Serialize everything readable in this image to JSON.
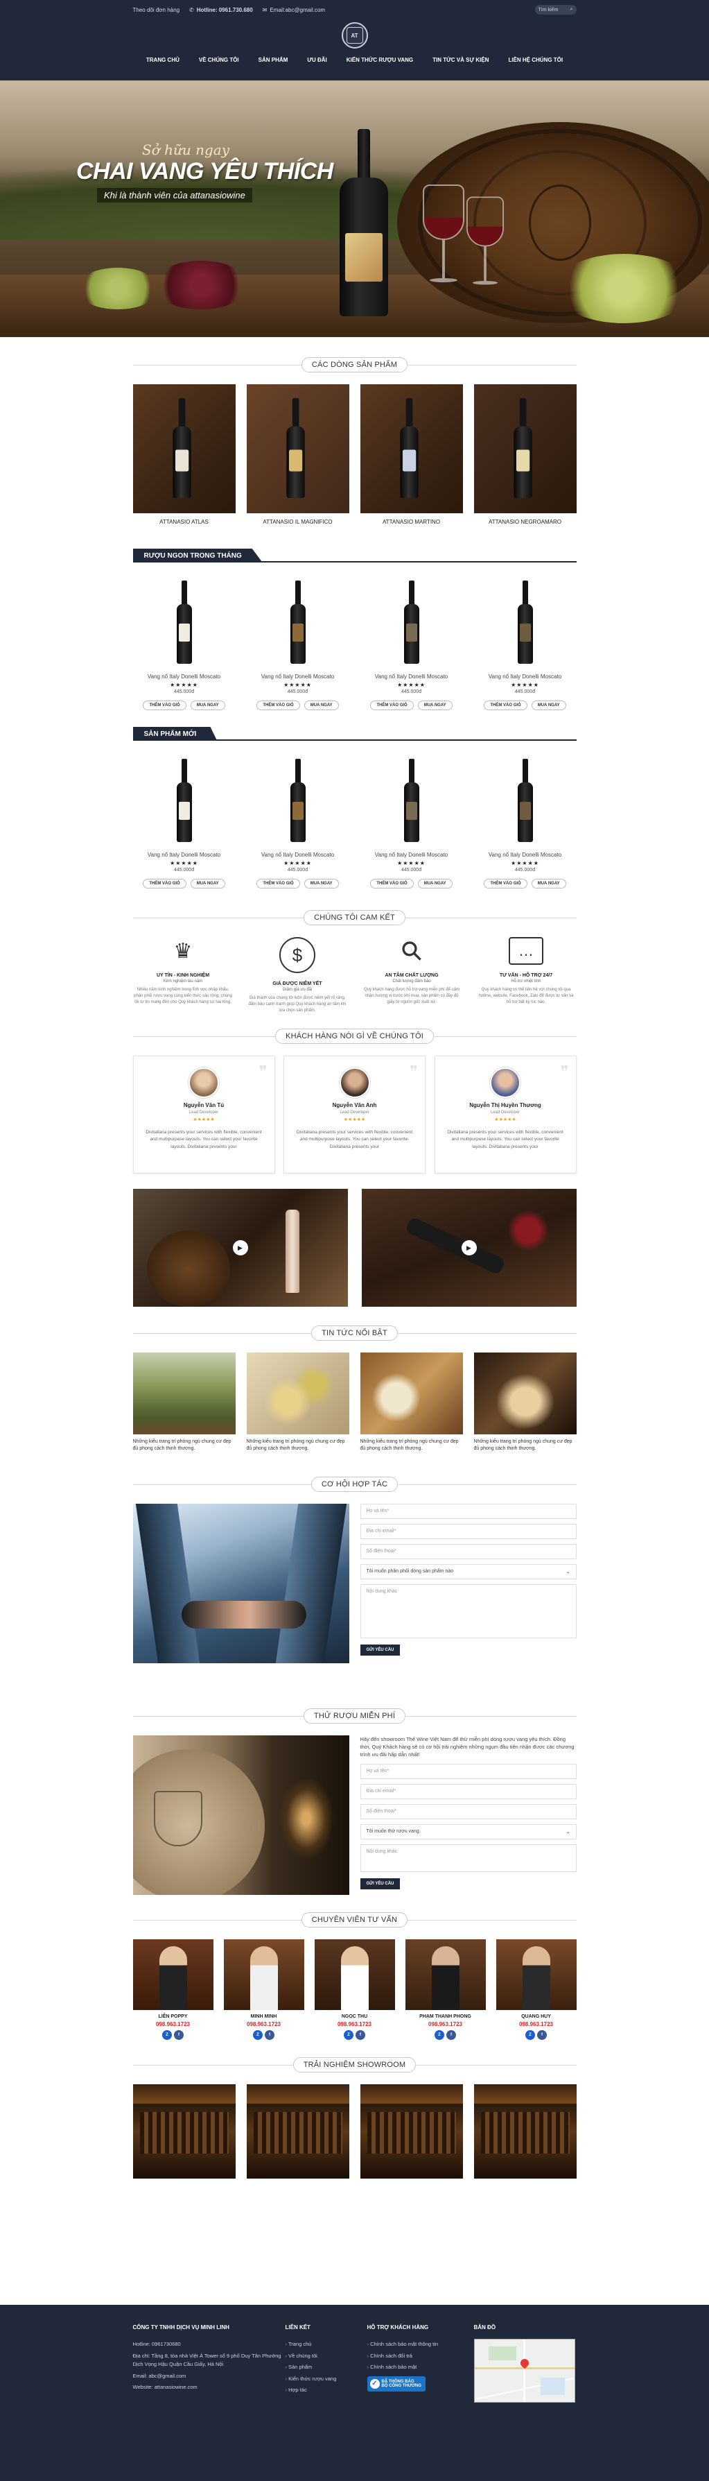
{
  "topbar": {
    "hours": "Theo dõi đơn hàng",
    "hotline": "Hotline: 0961.730.680",
    "email": "Email:abc@gmail.com",
    "search_placeholder": "Tìm kiếm"
  },
  "logo": {
    "text": "AT"
  },
  "nav": [
    "TRANG CHỦ",
    "VỀ CHÚNG TÔI",
    "SẢN PHẨM",
    "ƯU ĐÃI",
    "KIẾN THỨC RƯỢU VANG",
    "TIN TỨC VÀ SỰ KIỆN",
    "LIÊN HỆ CHÚNG TÔI"
  ],
  "hero": {
    "line1": "Sở hữu ngay",
    "line2": "CHAI VANG YÊU THÍCH",
    "line3": "Khi là thành viên của attanasiowine"
  },
  "categories": {
    "title": "CÁC DÒNG SẢN PHẨM",
    "items": [
      "ATTANASIO ATLAS",
      "ATTANASIO IL MAGNIFICO",
      "ATTANASIO MARTINO",
      "ATTANASIO NEGROAMARO"
    ]
  },
  "month_products": {
    "title": "RƯỢU NGON TRONG THÁNG",
    "items": [
      {
        "name": "Vang nổ Italy Donelli Moscato",
        "stars": "★★★★★",
        "price": "445.000đ"
      },
      {
        "name": "Vang nổ Italy Donelli Moscato",
        "stars": "★★★★★",
        "price": "445.000đ"
      },
      {
        "name": "Vang nổ Italy Donelli Moscato",
        "stars": "★★★★★",
        "price": "445.000đ"
      },
      {
        "name": "Vang nổ Italy Donelli Moscato",
        "stars": "★★★★★",
        "price": "445.000đ"
      }
    ],
    "cart_label": "THÊM VÀO GIỎ",
    "buy_label": "MUA NGAY"
  },
  "new_products": {
    "title": "SẢN PHẨM MỚI",
    "items": [
      {
        "name": "Vang nổ Italy Donelli Moscato",
        "stars": "★★★★★",
        "price": "445.000đ"
      },
      {
        "name": "Vang nổ Italy Donelli Moscato",
        "stars": "★★★★★",
        "price": "445.000đ"
      },
      {
        "name": "Vang nổ Italy Donelli Moscato",
        "stars": "★★★★★",
        "price": "445.000đ"
      },
      {
        "name": "Vang nổ Italy Donelli Moscato",
        "stars": "★★★★★",
        "price": "445.000đ"
      }
    ],
    "cart_label": "THÊM VÀO GIỎ",
    "buy_label": "MUA NGAY"
  },
  "commitments": {
    "title": "CHÚNG TÔI CAM KẾT",
    "items": [
      {
        "icon": "crown-person-icon",
        "glyph": "♛",
        "title": "UY TÍN - KINH NGHIỆM",
        "sub": "Kinh nghiệm lâu năm",
        "text": "Nhiều năm kinh nghiệm trong lĩnh vực nhập khẩu, phân phối rượu vang cùng kiến thức sâu rộng, chúng tôi tự tin mang đến cho Quý khách hàng sự hài lòng."
      },
      {
        "icon": "dollar-icon",
        "glyph": "$",
        "title": "GIÁ ĐƯỢC NIÊM YẾT",
        "sub": "Giảm giá ưu đãi",
        "text": "Giá thành của chúng tôi luôn được niêm yết rõ ràng, đảm bảo cạnh tranh giúp Quý khách hàng an tâm khi lựa chọn sản phẩm."
      },
      {
        "icon": "magnifier-icon",
        "glyph": "⚲",
        "title": "AN TÂM CHẤT LƯỢNG",
        "sub": "Chất lượng đảm bảo",
        "text": "Quý khách hàng được hỗ trợ vang miễn phí để cảm nhận hương vị trước khi mua, sản phẩm có đầy đủ giấy tờ nguồn gốc xuất xứ."
      },
      {
        "icon": "chat-icon",
        "glyph": "…",
        "title": "TƯ VẤN - HỖ TRỢ 24/7",
        "sub": "Hỗ trợ nhiệt tình",
        "text": "Quý khách hàng có thể liên hệ với chúng tôi qua hotline, website, Facebook, Zalo để được tư vấn và hỗ trợ bất kỳ lúc nào."
      }
    ]
  },
  "testimonials": {
    "title": "KHÁCH HÀNG NÓI GÌ VỀ CHÚNG TÔI",
    "items": [
      {
        "name": "Nguyễn Văn Tú",
        "role": "Lead Developer",
        "stars": "★★★★★",
        "text": "Divitaliana presents your services with flexible, convenient and multipurpose layouts. You can select your favorite layouts. Divitaliana presents your"
      },
      {
        "name": "Nguyễn Văn Anh",
        "role": "Lead Developer",
        "stars": "★★★★★",
        "text": "Divitaliana presents your services with flexible, convenient and multipurpose layouts. You can select your favorite. Divitaliana presents your"
      },
      {
        "name": "Nguyễn Thị Huyền Thương",
        "role": "Lead Developer",
        "stars": "★★★★★",
        "text": "Divitaliana presents your services with flexible, convenient and multipurpose layouts. You can select your favorite layouts. Divitaliana presents your"
      }
    ]
  },
  "news": {
    "title": "TIN TỨC NỔI BẬT",
    "items": [
      "Những kiểu trang trí phòng ngủ chung cư đẹp đủ phong cách thịnh thượng.",
      "Những kiểu trang trí phòng ngủ chung cư đẹp đủ phong cách thịnh thượng.",
      "Những kiểu trang trí phòng ngủ chung cư đẹp đủ phong cách thịnh thượng.",
      "Những kiểu trang trí phòng ngủ chung cư đẹp đủ phong cách thịnh thượng."
    ]
  },
  "cooperation": {
    "title": "CƠ HỘI HỢP TÁC",
    "name_ph": "Họ và tên*",
    "email_ph": "Địa chỉ email*",
    "phone_ph": "Số điện thoại*",
    "select": "Tôi muốn phân phối dòng sản phẩm nào",
    "msg_ph": "Nội dung khác",
    "submit": "GỬI YÊU CẦU"
  },
  "free_tasting": {
    "title": "THỬ RƯỢU MIỄN PHÍ",
    "intro": "Hãy đến showroom Thế Wine Việt Nam để thử miễn phí dòng rượu vang yêu thích. Đồng thời, Quý Khách hàng sẽ có cơ hội trải nghiệm những ngụm đầu tiên nhận được các chương trình ưu đãi hấp dẫn nhất!",
    "name_ph": "Họ và tên*",
    "email_ph": "Địa chỉ email*",
    "phone_ph": "Số điện thoại*",
    "select": "Tôi muốn thử rượu vang",
    "msg_ph": "Nội dung khác",
    "submit": "GỬI YÊU CẦU"
  },
  "advisors": {
    "title": "CHUYÊN VIÊN TƯ VẤN",
    "items": [
      {
        "name": "LIÊN POPPY",
        "phone": "098.963.1723"
      },
      {
        "name": "MINH MINH",
        "phone": "098.963.1723"
      },
      {
        "name": "NGỌC THU",
        "phone": "098.963.1723"
      },
      {
        "name": "PHẠM THANH PHONG",
        "phone": "098.963.1723"
      },
      {
        "name": "QUANG HUY",
        "phone": "098.963.1723"
      }
    ]
  },
  "showroom": {
    "title": "TRẢI NGHIỆM SHOWROOM"
  },
  "footer": {
    "company": "CÔNG TY TNHH DỊCH VỤ MINH LINH",
    "hotline": "Hotline: 0961730680",
    "address": "Địa chỉ: Tầng 8, tòa nhà Việt Á Tower số 9 phố Duy Tân Phường Dịch Vọng Hậu Quận Cầu Giấy, Hà Nội",
    "email": "Email: abc@gmail.com",
    "website": "Website: attanasiowine.com",
    "links_title": "LIÊN KẾT",
    "links": [
      "Trang chủ",
      "Về chúng tôi",
      "Sản phẩm",
      "Kiến thức rượu vang",
      "Hợp tác"
    ],
    "support_title": "HỖ TRỢ KHÁCH HÀNG",
    "support": [
      "Chính sách bảo mật thông tin",
      "Chính sách đổi trả",
      "Chính sách bảo mật"
    ],
    "bct_line1": "ĐÃ THÔNG BÁO",
    "bct_line2": "BỘ CÔNG THƯƠNG",
    "map_title": "BẢN ĐỒ"
  }
}
